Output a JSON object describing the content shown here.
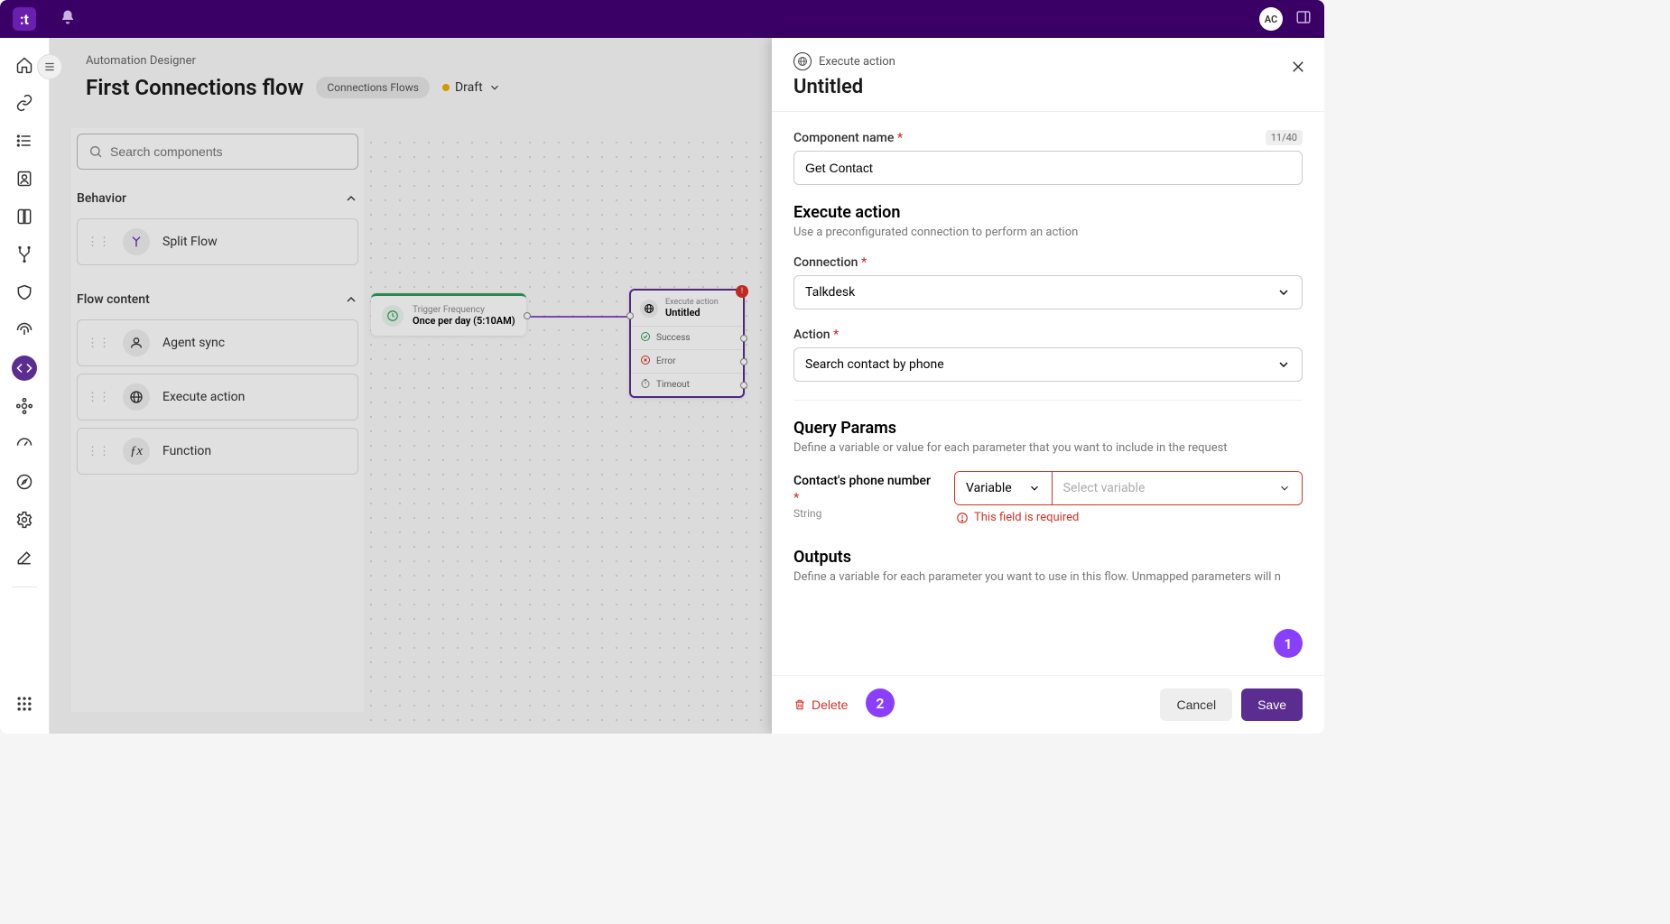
{
  "topbar": {
    "avatar": "AC"
  },
  "header": {
    "breadcrumb": "Automation Designer",
    "title": "First Connections flow",
    "tag": "Connections Flows",
    "status": "Draft"
  },
  "sidebar": {
    "search_placeholder": "Search components",
    "sections": {
      "behavior": {
        "label": "Behavior",
        "items": [
          "Split Flow"
        ]
      },
      "flow_content": {
        "label": "Flow content",
        "items": [
          "Agent sync",
          "Execute action",
          "Function"
        ]
      }
    }
  },
  "canvas": {
    "trigger": {
      "type": "Trigger Frequency",
      "value": "Once per day (5:10AM)"
    },
    "exec_node": {
      "type": "Execute action",
      "name": "Untitled",
      "outcomes": [
        "Success",
        "Error",
        "Timeout"
      ]
    }
  },
  "panel": {
    "type": "Execute action",
    "title": "Untitled",
    "component_name": {
      "label": "Component name",
      "value": "Get Contact",
      "counter": "11/40"
    },
    "execute": {
      "title": "Execute action",
      "desc": "Use a preconfigurated connection to perform an action",
      "connection": {
        "label": "Connection",
        "value": "Talkdesk"
      },
      "action": {
        "label": "Action",
        "value": "Search contact by phone"
      }
    },
    "query": {
      "title": "Query Params",
      "desc": "Define a variable or value for each parameter that you want to include in the request",
      "param1": {
        "label": "Contact's phone number",
        "type": "String",
        "mode": "Variable",
        "placeholder": "Select variable",
        "error": "This field is required"
      }
    },
    "outputs": {
      "title": "Outputs",
      "desc": "Define a variable for each parameter you want to use in this flow. Unmapped parameters will n"
    },
    "footer": {
      "delete": "Delete",
      "cancel": "Cancel",
      "save": "Save"
    }
  },
  "hints": {
    "one": "1",
    "two": "2"
  }
}
